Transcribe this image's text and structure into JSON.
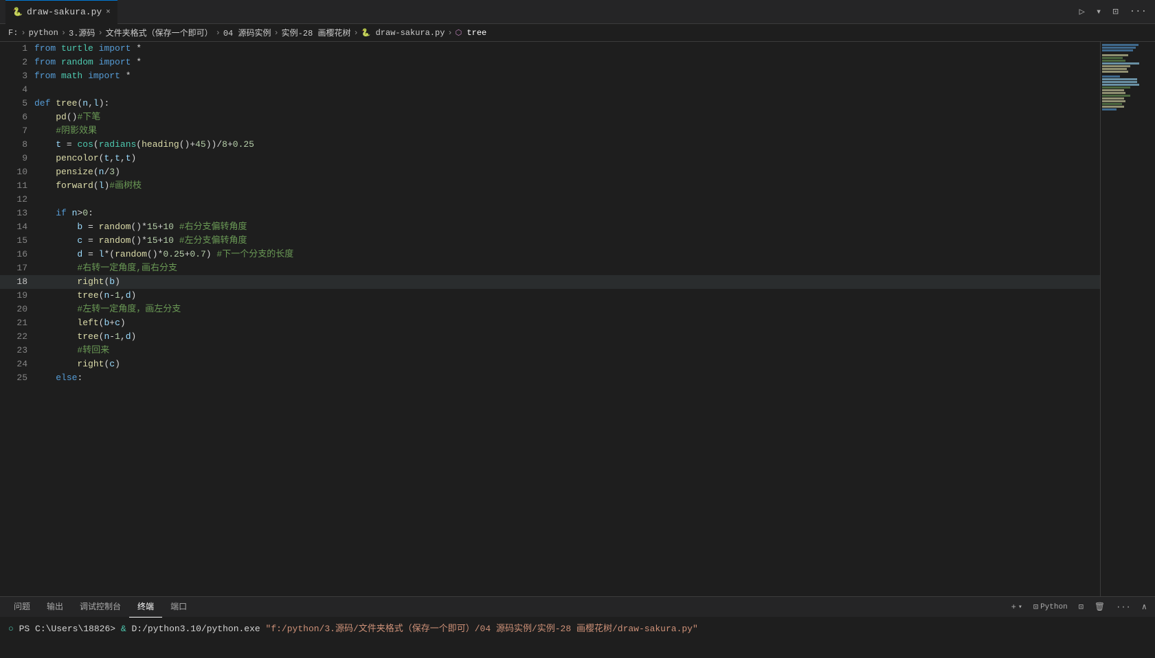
{
  "titleBar": {
    "tab": {
      "name": "draw-sakura.py",
      "icon": "🐍",
      "close": "×"
    },
    "actions": [
      "▷",
      "▾",
      "⊡",
      "···"
    ]
  },
  "breadcrumb": {
    "items": [
      "F:",
      "python",
      "3.源码",
      "文件夹格式（保存一个即可）",
      "04 源码实例",
      "实例-28 画樱花树",
      "draw-sakura.py",
      "tree"
    ],
    "separators": [
      ">",
      ">",
      ">",
      ">",
      ">",
      ">",
      ">"
    ]
  },
  "panelTabs": {
    "items": [
      "问题",
      "输出",
      "调试控制台",
      "终端",
      "端口"
    ],
    "active": "终端",
    "actions": {
      "+": "+",
      "python": "Python",
      "split": "⊡",
      "trash": "🗑",
      "more": "···",
      "close": "∧"
    }
  },
  "terminal": {
    "prompt": "PS C:\\Users\\18826>",
    "command": "& D:/python3.10/python.exe",
    "path": "\"f:/python/3.源码/文件夹格式（保存一个即可）/04 源码实例/实例-28 画樱花树/draw-sakura.py\""
  },
  "code": {
    "lines": [
      {
        "n": 1,
        "text": "from turtle import *"
      },
      {
        "n": 2,
        "text": "from random import *"
      },
      {
        "n": 3,
        "text": "from math import *"
      },
      {
        "n": 4,
        "text": ""
      },
      {
        "n": 5,
        "text": "def tree(n,l):"
      },
      {
        "n": 6,
        "text": "    pd()#下笔"
      },
      {
        "n": 7,
        "text": "    #阴影效果"
      },
      {
        "n": 8,
        "text": "    t = cos(radians(heading()+45))/8+0.25"
      },
      {
        "n": 9,
        "text": "    pencolor(t,t,t)"
      },
      {
        "n": 10,
        "text": "    pensize(n/3)"
      },
      {
        "n": 11,
        "text": "    forward(l)#画树枝"
      },
      {
        "n": 12,
        "text": ""
      },
      {
        "n": 13,
        "text": "    if n>0:"
      },
      {
        "n": 14,
        "text": "        b = random()*15+10 #右分支偏转角度"
      },
      {
        "n": 15,
        "text": "        c = random()*15+10 #左分支偏转角度"
      },
      {
        "n": 16,
        "text": "        d = l*(random()*0.25+0.7) #下一个分支的长度"
      },
      {
        "n": 17,
        "text": "        #右转一定角度,画右分支"
      },
      {
        "n": 18,
        "text": "        right(b)"
      },
      {
        "n": 19,
        "text": "        tree(n-1,d)"
      },
      {
        "n": 20,
        "text": "        #左转一定角度，画左分支"
      },
      {
        "n": 21,
        "text": "        left(b+c)"
      },
      {
        "n": 22,
        "text": "        tree(n-1,d)"
      },
      {
        "n": 23,
        "text": "        #转回来"
      },
      {
        "n": 24,
        "text": "        right(c)"
      },
      {
        "n": 25,
        "text": "    else:"
      }
    ]
  }
}
